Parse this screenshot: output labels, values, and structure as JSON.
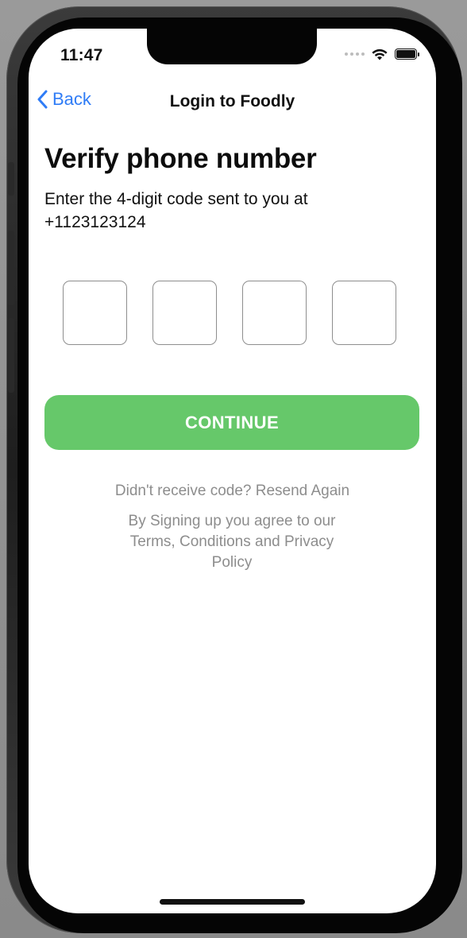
{
  "status_bar": {
    "time": "11:47",
    "icons": [
      "signal-dots-icon",
      "wifi-icon",
      "battery-icon"
    ]
  },
  "nav": {
    "back_label": "Back",
    "title": "Login to Foodly"
  },
  "main": {
    "heading": "Verify phone number",
    "instruction": "Enter the 4-digit code sent to you at +1123123124",
    "code_digits": [
      "",
      "",
      "",
      ""
    ],
    "continue_label": "CONTINUE",
    "resend_text": "Didn't receive code? Resend Again",
    "terms_text": "By Signing up you agree to our Terms, Conditions and Privacy Policy"
  },
  "colors": {
    "accent_blue": "#2f7cf6",
    "button_green": "#66c86a",
    "muted_text": "#8d8d8d",
    "box_border": "#8e8e8e"
  }
}
